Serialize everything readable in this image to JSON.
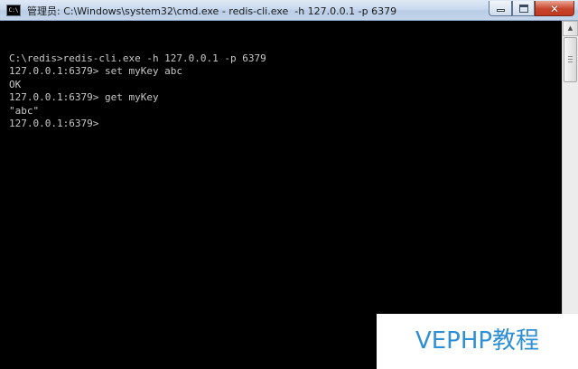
{
  "window": {
    "title": "管理员: C:\\Windows\\system32\\cmd.exe - redis-cli.exe  -h 127.0.0.1 -p 6379",
    "icon_text": "C:\\",
    "buttons": {
      "minimize_icon": "minimize-icon",
      "maximize_icon": "maximize-icon",
      "close_icon": "close-icon",
      "close_glyph": "✕"
    }
  },
  "console": {
    "lines": [
      "",
      "C:\\redis>redis-cli.exe -h 127.0.0.1 -p 6379",
      "127.0.0.1:6379> set myKey abc",
      "OK",
      "127.0.0.1:6379> get myKey",
      "\"abc\"",
      "127.0.0.1:6379>"
    ]
  },
  "scrollbar": {
    "up_arrow": "▲"
  },
  "watermark": {
    "text": "VEPHP教程"
  },
  "colors": {
    "console_bg": "#000000",
    "console_fg": "#c8c8c8",
    "watermark": "#2f8fd3",
    "close_button": "#c9452c"
  }
}
